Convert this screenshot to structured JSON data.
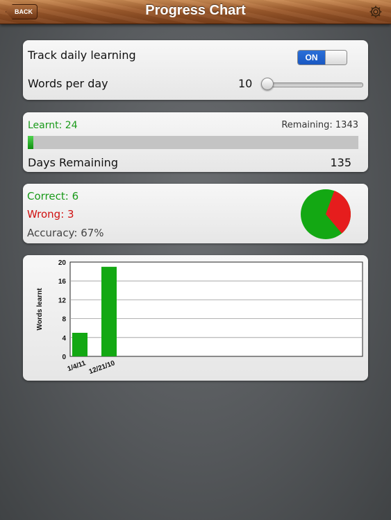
{
  "nav": {
    "back_label": "BACK",
    "title": "Progress Chart",
    "settings_icon": "gear-icon"
  },
  "settings": {
    "track_label": "Track daily learning",
    "toggle_label": "ON",
    "toggle_on": true,
    "words_label": "Words per day",
    "words_value": "10",
    "slider_fraction": 0.0
  },
  "progress": {
    "learnt_text": "Learnt: 24",
    "remaining_text": "Remaining: 1343",
    "learnt": 24,
    "remaining": 1343,
    "days_label": "Days Remaining",
    "days_value": "135"
  },
  "accuracy": {
    "correct_text": "Correct: 6",
    "wrong_text": "Wrong: 3",
    "accuracy_text": "Accuracy:  67%",
    "correct": 6,
    "wrong": 3
  },
  "colors": {
    "green": "#13a813",
    "red": "#e61d1d"
  },
  "chart_data": {
    "type": "bar",
    "categories": [
      "1/4/11",
      "12/21/10"
    ],
    "values": [
      5,
      19
    ],
    "ylabel": "Words learnt",
    "xlabel": "",
    "ylim": [
      0,
      20
    ],
    "yticks": [
      0,
      4,
      8,
      12,
      16,
      20
    ],
    "grid": true
  }
}
